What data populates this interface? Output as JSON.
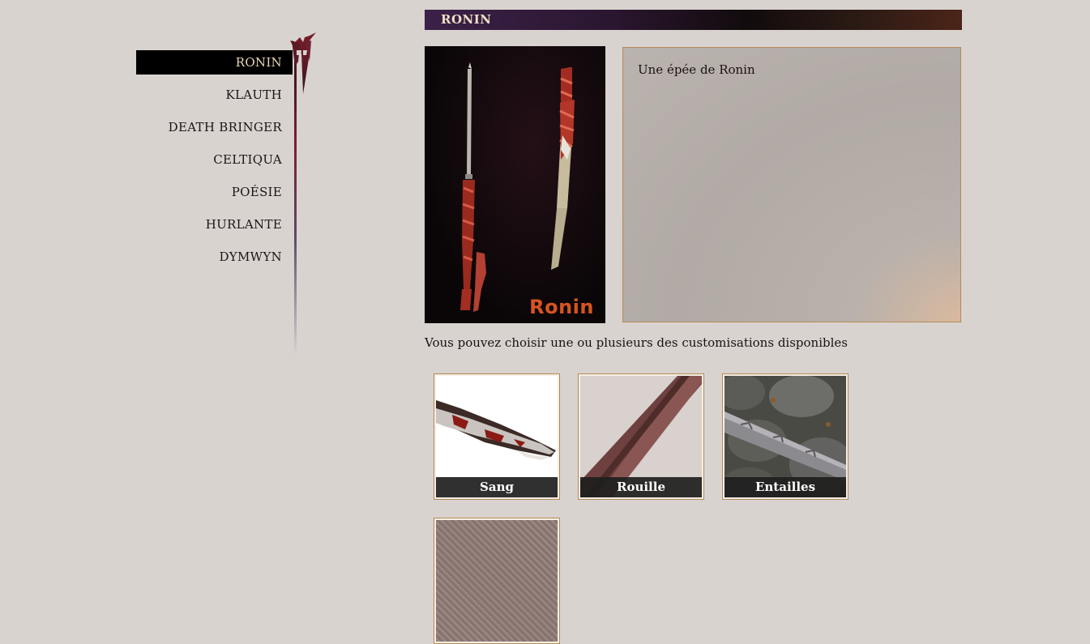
{
  "sidebar": {
    "items": [
      {
        "label": "RONIN",
        "active": true
      },
      {
        "label": "KLAUTH",
        "active": false
      },
      {
        "label": "DEATH BRINGER",
        "active": false
      },
      {
        "label": "CELTIQUA",
        "active": false
      },
      {
        "label": "POÉSIE",
        "active": false
      },
      {
        "label": "HURLANTE",
        "active": false
      },
      {
        "label": "DYMWYN",
        "active": false
      }
    ]
  },
  "product": {
    "title": "RONIN",
    "image_caption": "Ronin",
    "description": "Une épée de Ronin"
  },
  "customizations": {
    "hint": "Vous pouvez choisir une ou plusieurs des customisations disponibles",
    "items": [
      {
        "label": "Sang"
      },
      {
        "label": "Rouille"
      },
      {
        "label": "Entailles"
      },
      {
        "label": ""
      }
    ]
  },
  "colors": {
    "background": "#d9d3d0",
    "accent_gold": "#b48a56",
    "nav_active_bg": "#000000",
    "nav_active_text": "#e9d6b7",
    "brand_orange": "#d8541f"
  },
  "icons": {
    "site_logo": "emblem-icon"
  }
}
